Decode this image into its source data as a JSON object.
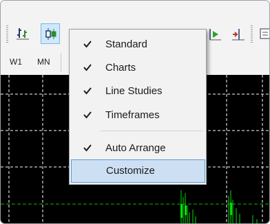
{
  "timeframes": [
    "W1",
    "MN"
  ],
  "toolbar": {
    "icons": [
      "chart-bars-icon",
      "candlesticks-icon",
      "line-chart-icon",
      "zoom-in-icon",
      "zoom-out-icon",
      "tile-windows-icon",
      "autoscroll-icon",
      "chart-shift-icon",
      "templates-icon"
    ]
  },
  "menu": {
    "items": [
      {
        "label": "Standard",
        "checked": true
      },
      {
        "label": "Charts",
        "checked": true
      },
      {
        "label": "Line Studies",
        "checked": true
      },
      {
        "label": "Timeframes",
        "checked": true
      },
      {
        "label": "Auto Arrange",
        "checked": true
      },
      {
        "label": "Customize",
        "checked": false,
        "highlighted": true
      }
    ]
  },
  "chart": {
    "background": "#000000",
    "grid_color": "#ffffff",
    "candle_color": "#00e000",
    "grid": true
  }
}
